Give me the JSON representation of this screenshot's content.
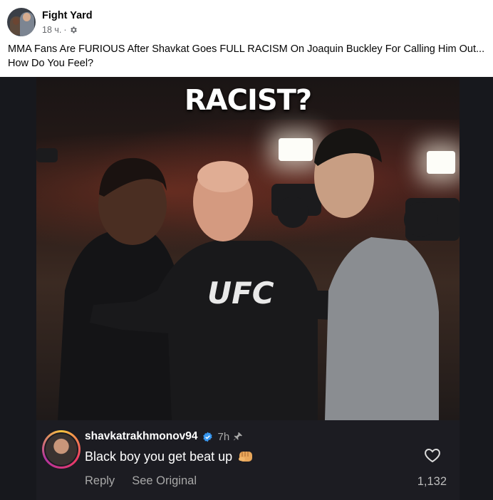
{
  "post": {
    "page_name": "Fight Yard",
    "time": "18 ч.",
    "separator": "·",
    "audience_icon": "gear-icon",
    "caption": "MMA Fans Are FURIOUS After Shavkat Goes FULL RACISM On Joaquin Buckley For Calling Him Out... How Do You Feel?"
  },
  "image": {
    "overlay_text": "RACIST?",
    "shirt_text": "UFC"
  },
  "comment": {
    "username": "shavkatrakhmonov94",
    "verified_icon": "verified-badge-icon",
    "time": "7h",
    "pin_icon": "pin-icon",
    "text": "Black boy you get beat up",
    "emoji_icon": "fist-icon",
    "reply_label": "Reply",
    "see_original_label": "See Original",
    "like_icon": "heart-icon",
    "like_count": "1,132"
  },
  "colors": {
    "text_primary": "#050505",
    "text_secondary": "#65676b",
    "comment_bg": "#1c1c22",
    "verified": "#3897f0"
  }
}
